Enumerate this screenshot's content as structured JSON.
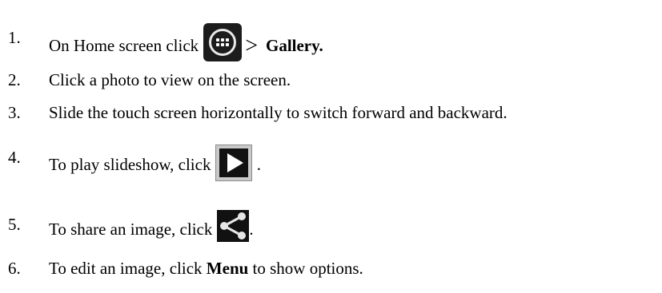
{
  "steps": [
    {
      "num": "1.",
      "pre": "On Home screen click",
      "gt": ">",
      "bold": "Gallery."
    },
    {
      "num": "2.",
      "text": "Click a photo to view on the screen."
    },
    {
      "num": "3.",
      "text": "Slide the touch screen horizontally to switch forward and backward."
    },
    {
      "num": "4.",
      "pre": "To play slideshow, click",
      "post": "."
    },
    {
      "num": "5.",
      "pre": "To share an image, click",
      "post": "."
    },
    {
      "num": "6.",
      "pre": "To edit an image, click",
      "bold": "Menu",
      "post": "to show options."
    }
  ],
  "icons": {
    "step1": "apps-launcher-icon",
    "step4": "play-icon",
    "step5": "share-icon"
  }
}
